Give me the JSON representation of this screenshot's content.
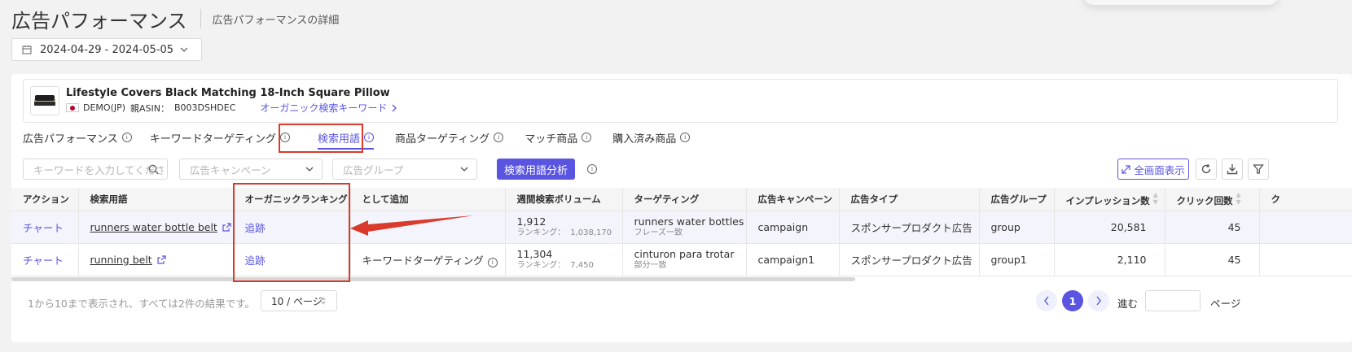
{
  "header": {
    "title": "広告パフォーマンス",
    "subtitle": "広告パフォーマンスの詳細"
  },
  "date_range": "2024-04-29 - 2024-05-05",
  "product": {
    "name": "Lifestyle Covers Black Matching 18-Inch Square Pillow",
    "marketplace": "DEMO(JP)",
    "parent_asin_label": "親ASIN：",
    "parent_asin": "B003DSHDEC",
    "organic_link": "オーガニック検索キーワード"
  },
  "tabs": [
    {
      "label": "広告パフォーマンス"
    },
    {
      "label": "キーワードターゲティング"
    },
    {
      "label": "検索用語"
    },
    {
      "label": "商品ターゲティング"
    },
    {
      "label": "マッチ商品"
    },
    {
      "label": "購入済み商品"
    }
  ],
  "active_tab": "検索用語",
  "filters": {
    "keyword_placeholder": "キーワードを入力してくださ",
    "campaign_placeholder": "広告キャンペーン",
    "group_placeholder": "広告グループ",
    "analysis_button": "検索用語分析",
    "fullscreen_button": "全画面表示"
  },
  "table": {
    "headers": [
      "アクション",
      "検索用語",
      "オーガニックランキング",
      "として追加",
      "週間検索ボリューム",
      "ターゲティング",
      "広告キャンペーン",
      "広告タイプ",
      "広告グループ",
      "インプレッション数",
      "クリック回数",
      "ク"
    ],
    "rows": [
      {
        "action": "チャート",
        "term": "runners water bottle belt",
        "organic": "追跡",
        "add_as": "",
        "volume": "1,912",
        "ranking_label": "ランキング：",
        "ranking": "1,038,170",
        "targeting": "runners water bottles",
        "match_type": "フレーズ一致",
        "campaign": "campaign",
        "ad_type": "スポンサープロダクト広告",
        "group": "group",
        "impressions": "20,581",
        "clicks": "45"
      },
      {
        "action": "チャート",
        "term": "running belt",
        "organic": "追跡",
        "add_as": "キーワードターゲティング",
        "volume": "11,304",
        "ranking_label": "ランキング：",
        "ranking": "7,450",
        "targeting": "cinturon para trotar",
        "match_type": "部分一致",
        "campaign": "campaign1",
        "ad_type": "スポンサープロダクト広告",
        "group": "group1",
        "impressions": "2,110",
        "clicks": "45"
      }
    ]
  },
  "footer": {
    "summary": "1から10まで表示され、すべては2件の結果です。",
    "page_size": "10 / ページ",
    "current_page": "1",
    "goto_label": "進む",
    "page_label": "ページ"
  },
  "colors": {
    "accent": "#5a55e0",
    "highlight": "#d93a2b"
  }
}
